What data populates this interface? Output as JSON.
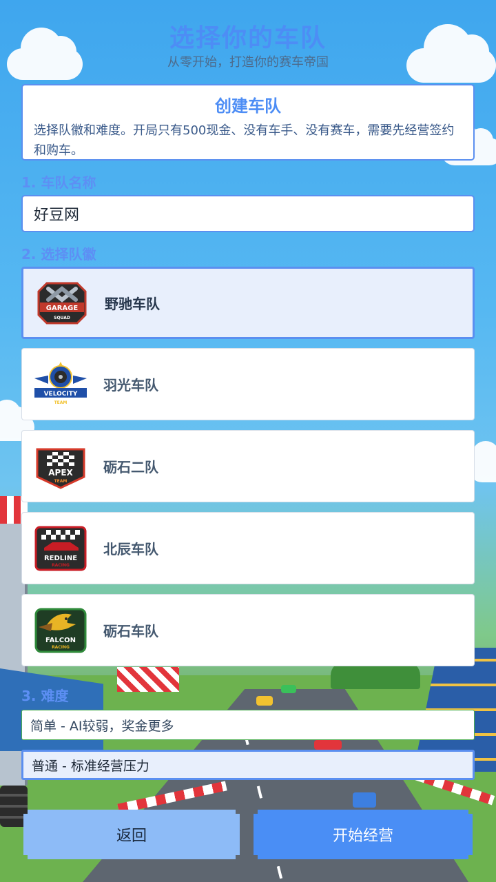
{
  "header": {
    "title": "选择你的车队",
    "subtitle": "从零开始，打造你的赛车帝国"
  },
  "info_card": {
    "title": "创建车队",
    "text": "选择队徽和难度。开局只有500现金、没有车手、没有赛车，需要先经营签约和购车。"
  },
  "team_name": {
    "label": "1. 车队名称",
    "value": "好豆网",
    "placeholder": ""
  },
  "badge_section": {
    "label": "2. 选择队徽",
    "options": [
      {
        "name": "野驰车队",
        "logo_text": "GARAGE",
        "logo_sub": "SQUAD",
        "selected": true,
        "logo_icon": "wrench-icon",
        "colors": {
          "primary": "#c0392b",
          "secondary": "#2b2b2b"
        }
      },
      {
        "name": "羽光车队",
        "logo_text": "VELOCITY",
        "logo_sub": "TEAM",
        "selected": false,
        "logo_icon": "wheel-icon",
        "colors": {
          "primary": "#1f4fa8",
          "secondary": "#f2c230"
        }
      },
      {
        "name": "砺石二队",
        "logo_text": "APEX",
        "logo_sub": "TEAM",
        "selected": false,
        "logo_icon": "checkered-flag-icon",
        "colors": {
          "primary": "#d63a2a",
          "secondary": "#f28b30"
        }
      },
      {
        "name": "北辰车队",
        "logo_text": "REDLINE",
        "logo_sub": "RACING",
        "selected": false,
        "logo_icon": "race-car-icon",
        "colors": {
          "primary": "#c81d25",
          "secondary": "#2b2b2b"
        }
      },
      {
        "name": "砺石车队",
        "logo_text": "FALCON",
        "logo_sub": "RACING",
        "selected": false,
        "logo_icon": "falcon-icon",
        "colors": {
          "primary": "#2f8a3a",
          "secondary": "#e8b425"
        }
      }
    ]
  },
  "difficulty": {
    "label": "3. 难度",
    "options": [
      {
        "label": "简单 - AI较弱，奖金更多",
        "selected": false
      },
      {
        "label": "普通 - 标准经营压力",
        "selected": true
      }
    ]
  },
  "buttons": {
    "back": "返回",
    "start": "开始经营"
  },
  "theme": {
    "accent": "#4a8ef5",
    "accent_light": "#8dbbf7",
    "selected_bg": "#e8effc"
  }
}
